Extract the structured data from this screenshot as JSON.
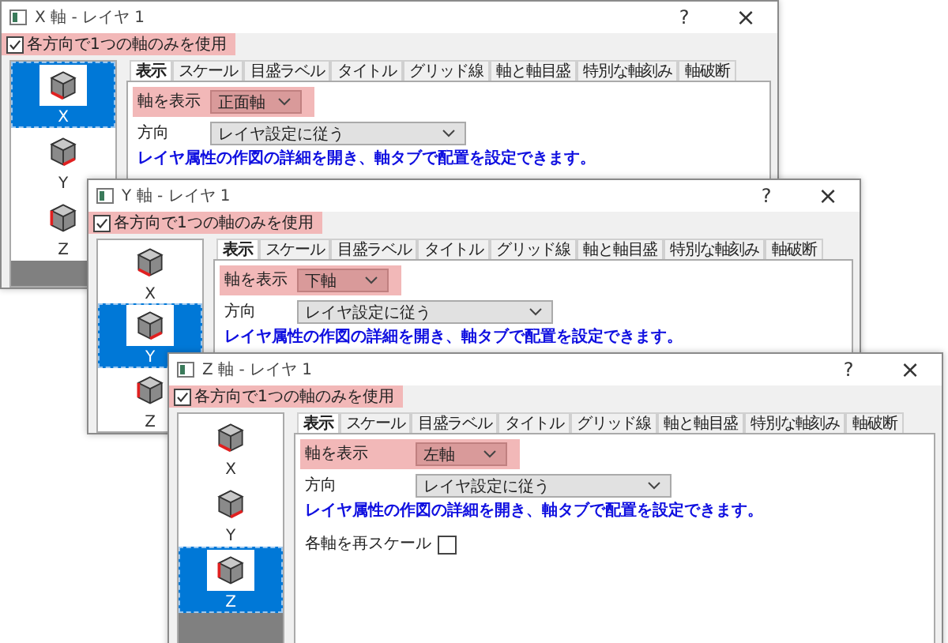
{
  "windows": [
    {
      "title": "X 軸 - レイヤ 1",
      "help": "?",
      "close": "×",
      "use_one_axis": {
        "label": "各方向で1つの軸のみを使用",
        "checked": true
      },
      "axes": [
        {
          "label": "X",
          "selected": true
        },
        {
          "label": "Y",
          "selected": false
        },
        {
          "label": "Z",
          "selected": false
        }
      ],
      "tabs": [
        {
          "label": "表示",
          "selected": true
        },
        {
          "label": "スケール",
          "selected": false
        },
        {
          "label": "目盛ラベル",
          "selected": false
        },
        {
          "label": "タイトル",
          "selected": false
        },
        {
          "label": "グリッド線",
          "selected": false
        },
        {
          "label": "軸と軸目盛",
          "selected": false
        },
        {
          "label": "特別な軸刻み",
          "selected": false
        },
        {
          "label": "軸破断",
          "selected": false
        }
      ],
      "show_axis": {
        "label": "軸を表示",
        "value": "正面軸"
      },
      "direction": {
        "label": "方向",
        "value": "レイヤ設定に従う"
      },
      "hint": "レイヤ属性の作図の詳細を開き、軸タブで配置を設定できます。"
    },
    {
      "title": "Y 軸 - レイヤ 1",
      "help": "?",
      "close": "×",
      "use_one_axis": {
        "label": "各方向で1つの軸のみを使用",
        "checked": true
      },
      "axes": [
        {
          "label": "X",
          "selected": false
        },
        {
          "label": "Y",
          "selected": true
        },
        {
          "label": "Z",
          "selected": false
        }
      ],
      "tabs": [
        {
          "label": "表示",
          "selected": true
        },
        {
          "label": "スケール",
          "selected": false
        },
        {
          "label": "目盛ラベル",
          "selected": false
        },
        {
          "label": "タイトル",
          "selected": false
        },
        {
          "label": "グリッド線",
          "selected": false
        },
        {
          "label": "軸と軸目盛",
          "selected": false
        },
        {
          "label": "特別な軸刻み",
          "selected": false
        },
        {
          "label": "軸破断",
          "selected": false
        }
      ],
      "show_axis": {
        "label": "軸を表示",
        "value": "下軸"
      },
      "direction": {
        "label": "方向",
        "value": "レイヤ設定に従う"
      },
      "hint": "レイヤ属性の作図の詳細を開き、軸タブで配置を設定できます。"
    },
    {
      "title": "Z 軸 - レイヤ 1",
      "help": "?",
      "close": "×",
      "use_one_axis": {
        "label": "各方向で1つの軸のみを使用",
        "checked": true
      },
      "axes": [
        {
          "label": "X",
          "selected": false
        },
        {
          "label": "Y",
          "selected": false
        },
        {
          "label": "Z",
          "selected": true
        }
      ],
      "tabs": [
        {
          "label": "表示",
          "selected": true
        },
        {
          "label": "スケール",
          "selected": false
        },
        {
          "label": "目盛ラベル",
          "selected": false
        },
        {
          "label": "タイトル",
          "selected": false
        },
        {
          "label": "グリッド線",
          "selected": false
        },
        {
          "label": "軸と軸目盛",
          "selected": false
        },
        {
          "label": "特別な軸刻み",
          "selected": false
        },
        {
          "label": "軸破断",
          "selected": false
        }
      ],
      "show_axis": {
        "label": "軸を表示",
        "value": "左軸"
      },
      "direction": {
        "label": "方向",
        "value": "レイヤ設定に従う"
      },
      "hint": "レイヤ属性の作図の詳細を開き、軸タブで配置を設定できます。",
      "rescale": {
        "label": "各軸を再スケール",
        "checked": false
      }
    }
  ]
}
